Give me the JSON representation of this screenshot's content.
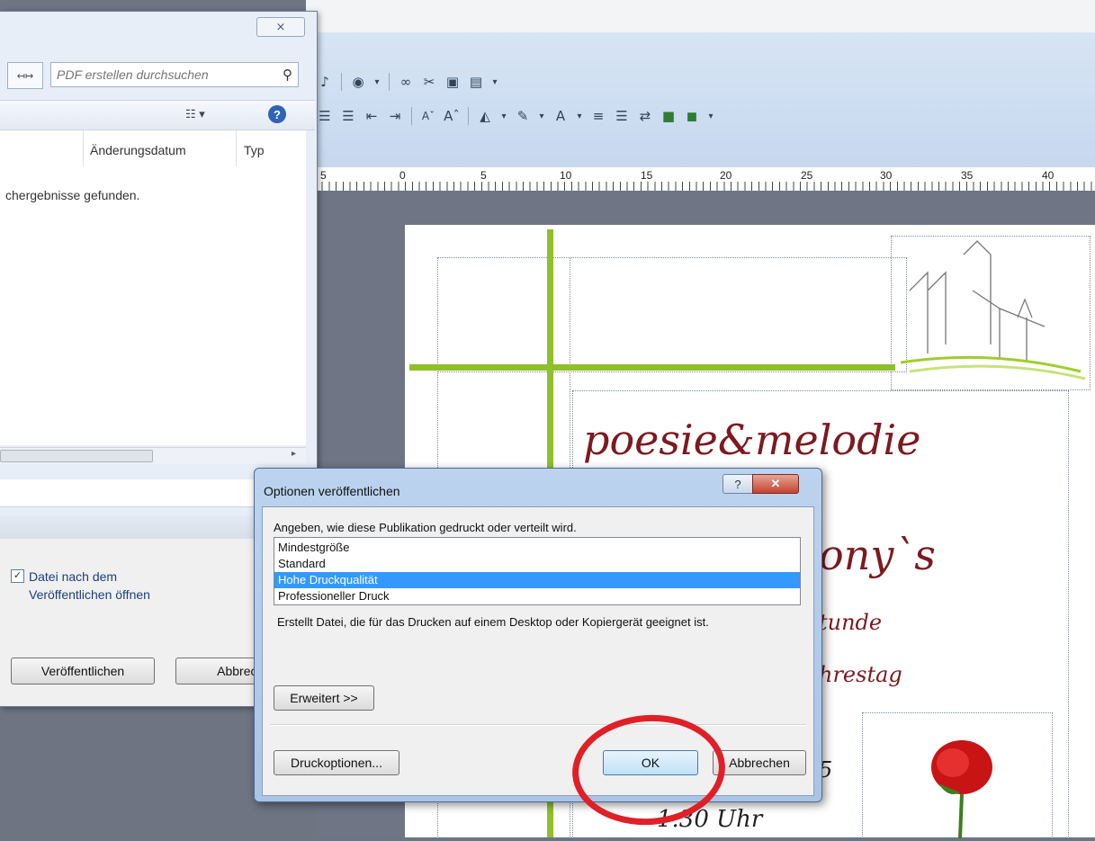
{
  "save_dialog": {
    "close_label": "⨯",
    "back_label": "↤↦",
    "search_placeholder": "PDF erstellen durchsuchen",
    "view_label": "☷ ▾",
    "help_label": "?",
    "col_date": "Änderungsdatum",
    "col_type": "Typ",
    "empty_text": "chergebnisse gefunden.",
    "open_after_label": "Datei nach dem Veröffentlichen öffnen",
    "open_after_checked": true,
    "publish_label": "Veröffentlichen",
    "cancel_label": "Abbrechen"
  },
  "publisher": {
    "ruler_numbers": [
      "5",
      "0",
      "5",
      "10",
      "15",
      "20",
      "25",
      "30",
      "35",
      "40"
    ],
    "poster_title": "poesie&melodie",
    "poster_line2": "ony`s",
    "poster_line3": "tunde",
    "poster_line4": "hrestag",
    "poster_line5": "5",
    "poster_time": "1.30 Uhr"
  },
  "options_dialog": {
    "title": "Optionen veröffentlichen",
    "help_label": "?",
    "close_label": "✕",
    "description": "Angeben, wie diese Publikation gedruckt oder verteilt wird.",
    "options": [
      "Mindestgröße",
      "Standard",
      "Hohe Druckqualität",
      "Professioneller Druck"
    ],
    "selected_option": "Hohe Druckqualität",
    "info": "Erstellt Datei, die für das Drucken auf einem Desktop oder Kopiergerät geeignet ist.",
    "advanced_label": "Erweitert >>",
    "print_options_label": "Druckoptionen...",
    "ok_label": "OK",
    "cancel_label": "Abbrechen"
  },
  "colors": {
    "selection": "#3399ff",
    "annotation_red": "#e01f27",
    "poster_text": "#7c1a1f",
    "guide_green": "#8fbf2a"
  }
}
